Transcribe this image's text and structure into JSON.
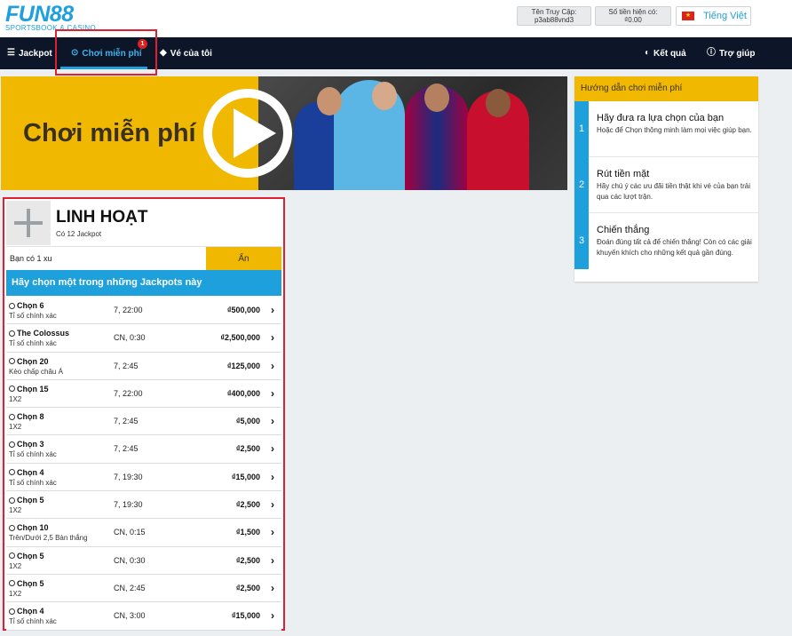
{
  "brand": {
    "name": "FUN88",
    "tagline": "SPORTSBOOK & CASINO",
    "accent": "#1ea0dc",
    "yellow": "#f0b800",
    "nav_bg": "#0d1629",
    "highlight": "#e02030"
  },
  "account": {
    "user_label": "Tên Truy Cập:",
    "user_value": "p3ab88vnd3",
    "balance_label": "Số tiền hiện có:",
    "balance_value": "₫0.00",
    "language": "Tiếng Việt"
  },
  "nav": {
    "jackpot": "Jackpot",
    "free_play": "Chơi miễn phí",
    "free_play_badge": "1",
    "my_tickets": "Vé của tôi",
    "results": "Kết quả",
    "help": "Trợ giúp"
  },
  "banner": {
    "title": "Chơi miễn phí"
  },
  "panel": {
    "title": "LINH HOẠT",
    "subtitle": "Có 12 Jackpot",
    "coins": "Bạn có 1 xu",
    "hide_label": "Ẩn",
    "choose_label": "Hãy chọn một trong những Jackpots này",
    "rows": [
      {
        "name": "Chọn 6",
        "type": "Tỉ số chính xác",
        "time": "7, 22:00",
        "prize": "₫500,000"
      },
      {
        "name": "The Colossus",
        "type": "Tỉ số chính xác",
        "time": "CN, 0:30",
        "prize": "₫2,500,000"
      },
      {
        "name": "Chọn 20",
        "type": "Kèo chấp châu Á",
        "time": "7, 2:45",
        "prize": "₫125,000"
      },
      {
        "name": "Chọn 15",
        "type": "1X2",
        "time": "7, 22:00",
        "prize": "₫400,000"
      },
      {
        "name": "Chọn 8",
        "type": "1X2",
        "time": "7, 2:45",
        "prize": "₫5,000"
      },
      {
        "name": "Chọn 3",
        "type": "Tỉ số chính xác",
        "time": "7, 2:45",
        "prize": "₫2,500"
      },
      {
        "name": "Chọn 4",
        "type": "Tỉ số chính xác",
        "time": "7, 19:30",
        "prize": "₫15,000"
      },
      {
        "name": "Chọn 5",
        "type": "1X2",
        "time": "7, 19:30",
        "prize": "₫2,500"
      },
      {
        "name": "Chọn 10",
        "type": "Trên/Dưới 2,5 Bàn thắng",
        "time": "CN, 0:15",
        "prize": "₫1,500"
      },
      {
        "name": "Chọn 5",
        "type": "1X2",
        "time": "CN, 0:30",
        "prize": "₫2,500"
      },
      {
        "name": "Chọn 5",
        "type": "1X2",
        "time": "CN, 2:45",
        "prize": "₫2,500"
      },
      {
        "name": "Chọn 4",
        "type": "Tỉ số chính xác",
        "time": "CN, 3:00",
        "prize": "₫15,000"
      }
    ]
  },
  "guide": {
    "title": "Hướng dẫn chơi miễn phí",
    "steps": [
      {
        "num": "1",
        "title": "Hãy đưa ra lựa chọn của bạn",
        "desc": "Hoặc để Chọn thông minh làm mọi việc giúp bạn."
      },
      {
        "num": "2",
        "title": "Rút tiền mặt",
        "desc": "Hãy chú ý các ưu đãi tiền thật khi vé của bạn trải qua các lượt trận."
      },
      {
        "num": "3",
        "title": "Chiến thắng",
        "desc": "Đoán đúng tất cả để chiến thắng! Còn có các giải khuyến khích cho những kết quả gần đúng."
      }
    ]
  }
}
